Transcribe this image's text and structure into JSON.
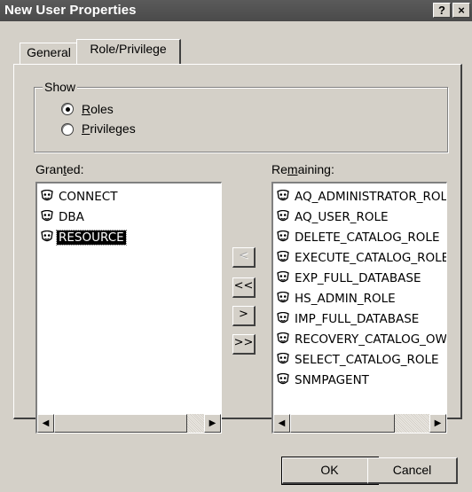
{
  "window": {
    "title": "New User Properties",
    "help_label": "?",
    "close_label": "×"
  },
  "tabs": [
    {
      "label": "General",
      "active": false
    },
    {
      "label": "Role/Privilege",
      "active": true
    }
  ],
  "show_group": {
    "label": "Show",
    "options": [
      {
        "label": "Roles",
        "mnemonic": "R",
        "rest": "oles",
        "selected": true
      },
      {
        "label": "Privileges",
        "mnemonic": "P",
        "rest": "rivileges",
        "selected": false
      }
    ]
  },
  "granted": {
    "label_pre": "Gran",
    "label_mnemonic": "t",
    "label_post": "ed:",
    "items": [
      {
        "label": "CONNECT",
        "selected": false
      },
      {
        "label": "DBA",
        "selected": false
      },
      {
        "label": "RESOURCE",
        "selected": true
      }
    ]
  },
  "remaining": {
    "label_pre": "Re",
    "label_mnemonic": "m",
    "label_post": "aining:",
    "items": [
      {
        "label": "AQ_ADMINISTRATOR_ROLE"
      },
      {
        "label": "AQ_USER_ROLE"
      },
      {
        "label": "DELETE_CATALOG_ROLE"
      },
      {
        "label": "EXECUTE_CATALOG_ROLE"
      },
      {
        "label": "EXP_FULL_DATABASE"
      },
      {
        "label": "HS_ADMIN_ROLE"
      },
      {
        "label": "IMP_FULL_DATABASE"
      },
      {
        "label": "RECOVERY_CATALOG_OWNER"
      },
      {
        "label": "SELECT_CATALOG_ROLE"
      },
      {
        "label": "SNMPAGENT"
      }
    ]
  },
  "move_buttons": {
    "add_one": "<",
    "add_all": "<<",
    "remove_one": ">",
    "remove_all": ">>"
  },
  "scroll": {
    "left_arrow": "◀",
    "right_arrow": "▶"
  },
  "footer": {
    "ok_label": "OK",
    "cancel_label": "Cancel"
  },
  "colors": {
    "title_bar": "#4a4a4a",
    "face": "#d4d0c8",
    "selection": "#000000"
  },
  "icons": {
    "role_item": "role-mask-icon"
  }
}
